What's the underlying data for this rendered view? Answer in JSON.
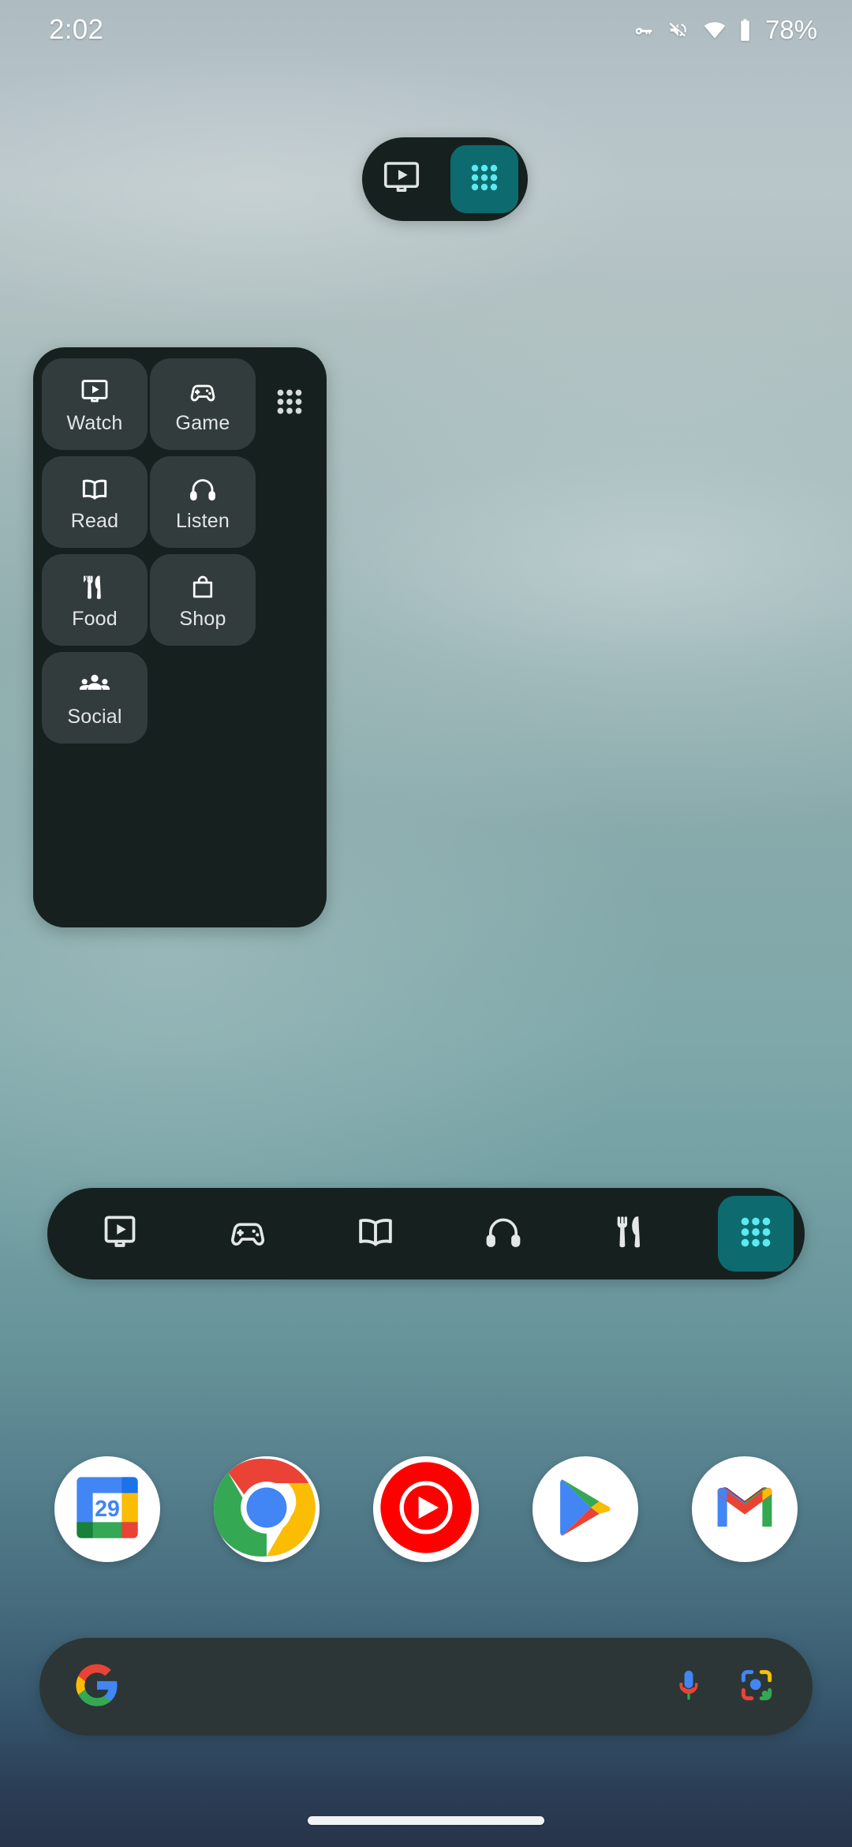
{
  "status_bar": {
    "clock": "2:02",
    "battery_percent": "78%",
    "icons": [
      "vpn-key-icon",
      "volume-mute-icon",
      "wifi-icon",
      "battery-icon"
    ]
  },
  "mini_pill_widget": {
    "name": "category-switcher-pill",
    "selected_category_icon": "watch-icon",
    "all_apps_icon": "all-apps-dots-icon",
    "accent_color": "#0d6b70",
    "dot_color": "#5ce9f0",
    "background_color": "#16211f"
  },
  "category_panel": {
    "background_color": "#16211f",
    "tile_color": "#323c3c",
    "all_apps_icon": "all-apps-dots-icon",
    "tiles": [
      {
        "label": "Watch",
        "icon": "watch-icon"
      },
      {
        "label": "Game",
        "icon": "gamepad-icon"
      },
      {
        "label": "Read",
        "icon": "open-book-icon"
      },
      {
        "label": "Listen",
        "icon": "headphones-icon"
      },
      {
        "label": "Food",
        "icon": "fork-knife-icon"
      },
      {
        "label": "Shop",
        "icon": "shopping-bag-icon"
      },
      {
        "label": "Social",
        "icon": "people-group-icon"
      }
    ]
  },
  "wide_bar_widget": {
    "background_color": "#16211f",
    "accent_color": "#0d6b70",
    "dot_color": "#5ce9f0",
    "icons": [
      {
        "name": "watch-icon"
      },
      {
        "name": "gamepad-icon"
      },
      {
        "name": "open-book-icon"
      },
      {
        "name": "headphones-icon"
      },
      {
        "name": "fork-knife-icon"
      }
    ],
    "all_apps_icon": "all-apps-dots-icon"
  },
  "app_row": {
    "apps": [
      {
        "name": "google-calendar-icon",
        "label": "Calendar",
        "date_number": "29"
      },
      {
        "name": "google-chrome-icon",
        "label": "Chrome"
      },
      {
        "name": "youtube-music-icon",
        "label": "YT Music"
      },
      {
        "name": "google-play-store-icon",
        "label": "Play Store"
      },
      {
        "name": "gmail-icon",
        "label": "Gmail"
      }
    ]
  },
  "search_widget": {
    "google_logo": "google-g-icon",
    "value": "",
    "placeholder": "",
    "mic_icon": "microphone-icon",
    "lens_icon": "google-lens-icon",
    "background_color": "#2c3636"
  },
  "navigation": {
    "gesture_handle": "home-gesture-bar"
  }
}
